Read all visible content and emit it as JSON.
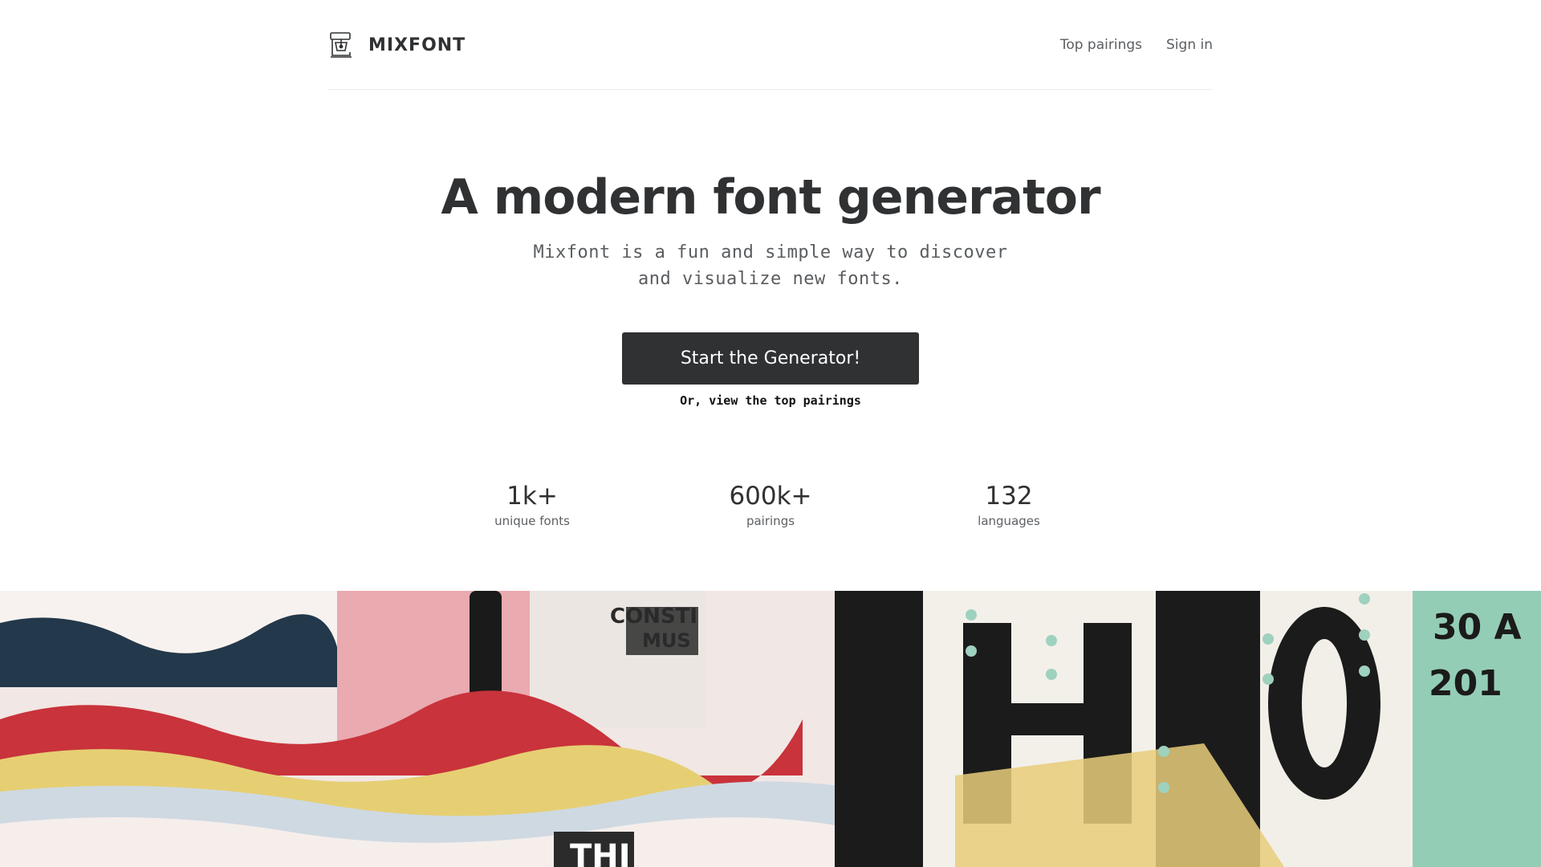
{
  "brand": {
    "name": "MIXFONT",
    "icon": "stand-mixer-icon"
  },
  "nav": {
    "items": [
      "Top pairings",
      "Sign in"
    ]
  },
  "hero": {
    "title": "A modern font generator",
    "subtitle_line1": "Mixfont is a fun and simple way to discover",
    "subtitle_line2": "and visualize new fonts.",
    "cta_label": "Start the Generator!",
    "alt_link": "Or, view the top pairings"
  },
  "stats": [
    {
      "value": "1k+",
      "label": "unique fonts"
    },
    {
      "value": "600k+",
      "label": "pairings"
    },
    {
      "value": "132",
      "label": "languages"
    }
  ],
  "collage": {
    "description_colors": [
      "#1f2d3a",
      "#e9a3a9",
      "#d8343b",
      "#e9d47a",
      "#9bd0bd",
      "#f4ecea"
    ],
    "poster_text": [
      "CONSTI",
      "MUS",
      "THI",
      "HICO",
      "30 A",
      "201"
    ]
  },
  "colors": {
    "text": "#2f3133",
    "cta_bg": "#2f3133",
    "muted": "#5b5e61",
    "divider": "#ececec"
  }
}
